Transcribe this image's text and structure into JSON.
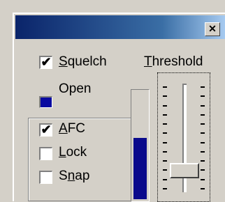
{
  "window": {
    "close_glyph": "✕"
  },
  "squelch": {
    "label_accel": "S",
    "label_rest": "quelch",
    "checked": true,
    "check_glyph": "✔"
  },
  "open": {
    "label": "Open",
    "led_color": "#0a0aa0"
  },
  "threshold": {
    "label_accel": "T",
    "label_rest": "hreshold",
    "value": 0.08,
    "tick_count": 12
  },
  "meter": {
    "level": 0.57,
    "color": "#0a0a8c"
  },
  "afc": {
    "label_accel": "A",
    "label_rest": "FC",
    "checked": true,
    "check_glyph": "✔"
  },
  "lock": {
    "label_accel": "L",
    "label_rest": "ock",
    "checked": false
  },
  "snap": {
    "label_pre": "S",
    "label_accel": "n",
    "label_rest": "ap",
    "checked": false
  }
}
